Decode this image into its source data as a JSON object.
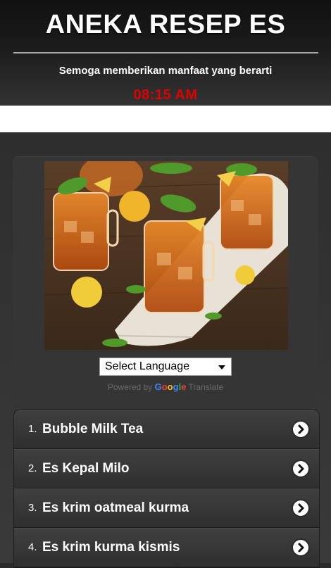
{
  "header": {
    "title": "ANEKA RESEP ES",
    "subtitle": "Semoga memberikan manfaat yang berarti",
    "clock": "08:15 AM"
  },
  "hero_image": {
    "subject": "iced tea in mason jars with mint and lemon"
  },
  "translate": {
    "select_label": "Select Language",
    "powered_prefix": "Powered by",
    "google_letters": [
      "G",
      "o",
      "o",
      "g",
      "l",
      "e"
    ],
    "translate_word": "Translate"
  },
  "recipes": [
    {
      "number": "1.",
      "name": "Bubble Milk Tea"
    },
    {
      "number": "2.",
      "name": "Es Kepal Milo"
    },
    {
      "number": "3.",
      "name": "Es krim oatmeal kurma"
    },
    {
      "number": "4.",
      "name": "Es krim kurma kismis"
    }
  ],
  "colors": {
    "clock": "#e00000",
    "header_bg": "#1a1a1a",
    "list_bg": "#353535"
  }
}
